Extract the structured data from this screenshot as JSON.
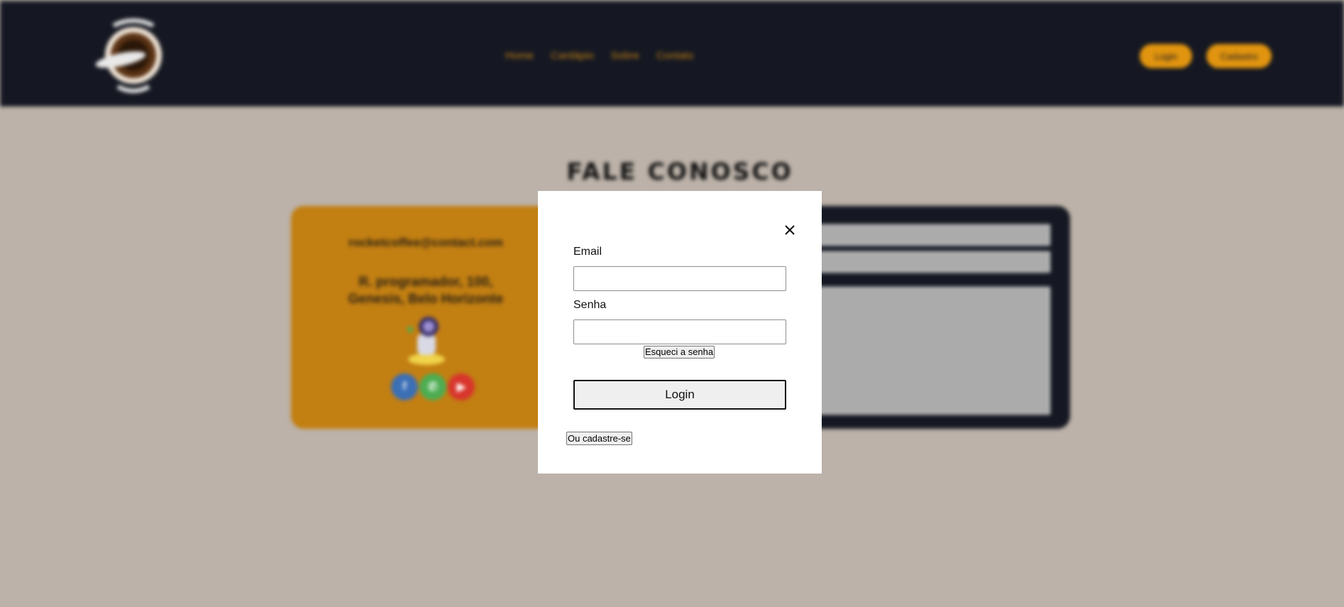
{
  "background": {
    "nav": {
      "links": [
        "Home",
        "Cardápio",
        "Sobre",
        "Contato"
      ],
      "login_label": "Login",
      "signup_label": "Cadastro"
    },
    "section_title": "FALE CONOSCO",
    "contact": {
      "email": "rocketcoffee@contact.com",
      "address": "R. programador, 100, Genesis, Belo Horizonte",
      "social": [
        "facebook-icon",
        "whatsapp-icon",
        "youtube-icon"
      ]
    },
    "colors": {
      "nav_bg": "#151822",
      "accent": "#e1940f",
      "page_bg": "#bcb2a9"
    }
  },
  "modal": {
    "email_label": "Email",
    "email_value": "",
    "password_label": "Senha",
    "password_value": "",
    "forgot_label": "Esqueci a senha",
    "login_label": "Login",
    "signup_label": "Ou cadastre-se",
    "close_icon": "close-icon"
  }
}
